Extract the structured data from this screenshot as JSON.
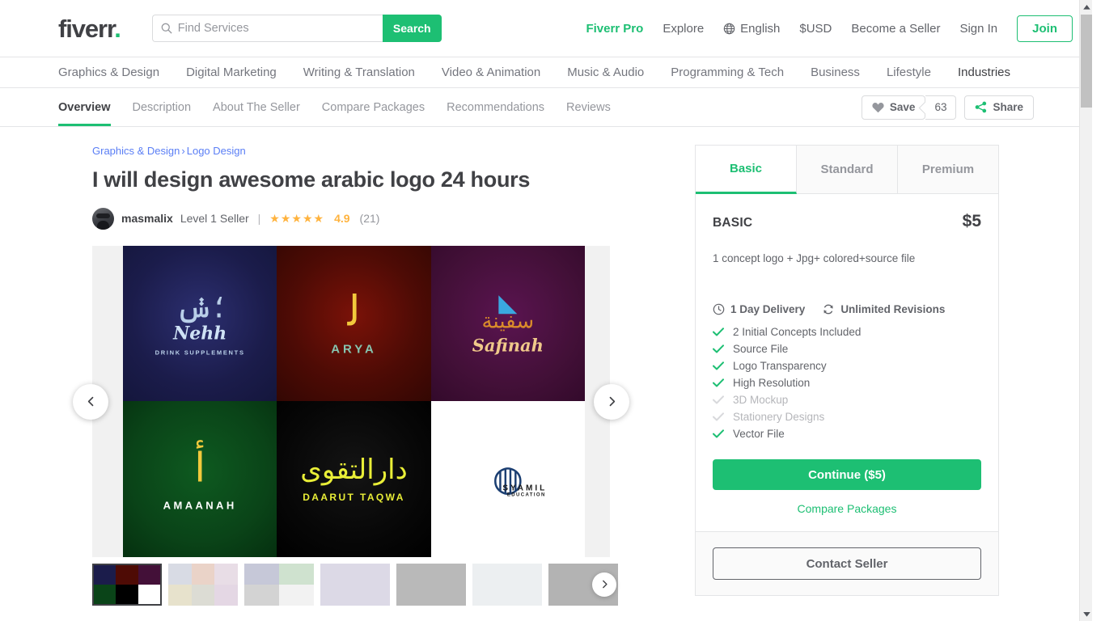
{
  "header": {
    "logo_text": "fiverr",
    "logo_dot": ".",
    "search_placeholder": "Find Services",
    "search_value": "",
    "search_button": "Search",
    "links": [
      {
        "label": "Fiverr Pro",
        "style": "pro"
      },
      {
        "label": "Explore",
        "style": "normal"
      },
      {
        "label": "English",
        "style": "normal",
        "icon": "globe-icon"
      },
      {
        "label": "$USD",
        "style": "normal"
      },
      {
        "label": "Become a Seller",
        "style": "normal"
      },
      {
        "label": "Sign In",
        "style": "normal"
      }
    ],
    "join_button": "Join"
  },
  "category_nav": {
    "items": [
      {
        "label": "Graphics & Design",
        "active": false
      },
      {
        "label": "Digital Marketing",
        "active": false
      },
      {
        "label": "Writing & Translation",
        "active": false
      },
      {
        "label": "Video & Animation",
        "active": false
      },
      {
        "label": "Music & Audio",
        "active": false
      },
      {
        "label": "Programming & Tech",
        "active": false
      },
      {
        "label": "Business",
        "active": false
      },
      {
        "label": "Lifestyle",
        "active": false
      },
      {
        "label": "Industries",
        "active": true
      }
    ]
  },
  "sub_nav": {
    "tabs": [
      {
        "label": "Overview",
        "active": true
      },
      {
        "label": "Description",
        "active": false
      },
      {
        "label": "About The Seller",
        "active": false
      },
      {
        "label": "Compare Packages",
        "active": false
      },
      {
        "label": "Recommendations",
        "active": false
      },
      {
        "label": "Reviews",
        "active": false
      }
    ],
    "save_label": "Save",
    "save_count": "63",
    "share_label": "Share"
  },
  "gig": {
    "breadcrumb": {
      "category": "Graphics & Design",
      "separator": "›",
      "subcategory": "Logo Design"
    },
    "title": "I will design awesome arabic logo 24 hours",
    "seller": {
      "name": "masmalix",
      "level": "Level 1 Seller",
      "divider": "|",
      "stars": "★★★★★",
      "rating": "4.9",
      "review_count": "(21)"
    }
  },
  "gallery": {
    "prev_label": "‹",
    "next_label": "›",
    "thumbs_next_label": "›",
    "slides": [
      {
        "name": "Nehh",
        "sub": "DRINK SUPPLEMENTS",
        "bg": "#1b1c4b",
        "fg": "#b9cfe8",
        "accent": "#e3c24a"
      },
      {
        "name": "ARYA",
        "sub": "",
        "bg": "#4e0b05",
        "fg": "#86c5b0",
        "accent": "#f2c93c"
      },
      {
        "name": "Safinah",
        "sub": "",
        "bg": "#431038",
        "fg": "#f0c98a",
        "accent": "#3aa8e0"
      },
      {
        "name": "AMAANAH",
        "sub": "",
        "bg": "#0a4418",
        "fg": "#ffffff",
        "accent": "#f2c93c"
      },
      {
        "name": "DAARUT TAQWA",
        "sub": "",
        "bg": "#000000",
        "fg": "#e9ee37",
        "accent": "#e9ee37"
      },
      {
        "name": "SYAMIL",
        "sub": "EDUCATION",
        "bg": "#ffffff",
        "fg": "#1c3f72",
        "accent": "#1c3f72"
      }
    ],
    "thumbnails": [
      {
        "label": "thumbnail-1",
        "active": true,
        "colors": [
          "#1b1c4b",
          "#4e0b05",
          "#431038",
          "#0a4418",
          "#000000",
          "#ffffff"
        ]
      },
      {
        "label": "thumbnail-2",
        "active": false,
        "colors": [
          "#d8dbe4",
          "#ead3c8",
          "#e8dde6",
          "#e7e2cc",
          "#dcdcd4",
          "#e4d7e4"
        ]
      },
      {
        "label": "thumbnail-3",
        "active": false,
        "colors": [
          "#c6c8d8",
          "#cfe2cf",
          "#c6c8d8",
          "#cfe2cf",
          "#d3d3d3",
          "#f2f2f2"
        ]
      },
      {
        "label": "thumbnail-4",
        "active": false,
        "colors": [
          "#dcd9e6",
          "#dcd9e6",
          "#dcd9e6",
          "#dcd9e6",
          "#dcd9e6",
          "#dcd9e6"
        ]
      },
      {
        "label": "thumbnail-5",
        "active": false,
        "colors": [
          "#b9b9b9",
          "#b9b9b9",
          "#b9b9b9",
          "#b9b9b9",
          "#b9b9b9",
          "#b9b9b9"
        ]
      },
      {
        "label": "thumbnail-6",
        "active": false,
        "colors": [
          "#eceff1",
          "#eceff1",
          "#eceff1",
          "#eceff1",
          "#eceff1",
          "#eceff1"
        ]
      },
      {
        "label": "thumbnail-7",
        "active": false,
        "colors": [
          "#b3b3b3",
          "#b3b3b3",
          "#b3b3b3",
          "#b3b3b3",
          "#b3b3b3",
          "#b3b3b3"
        ]
      }
    ]
  },
  "package": {
    "tabs": [
      {
        "label": "Basic",
        "active": true
      },
      {
        "label": "Standard",
        "active": false
      },
      {
        "label": "Premium",
        "active": false
      }
    ],
    "name": "BASIC",
    "price": "$5",
    "description": "1 concept logo + Jpg+ colored+source file",
    "delivery": "1 Day Delivery",
    "revisions": "Unlimited Revisions",
    "features": [
      {
        "label": "2 Initial Concepts Included",
        "included": true
      },
      {
        "label": "Source File",
        "included": true
      },
      {
        "label": "Logo Transparency",
        "included": true
      },
      {
        "label": "High Resolution",
        "included": true
      },
      {
        "label": "3D Mockup",
        "included": false
      },
      {
        "label": "Stationery Designs",
        "included": false
      },
      {
        "label": "Vector File",
        "included": true
      }
    ],
    "continue_button": "Continue ($5)",
    "compare_link": "Compare Packages",
    "contact_button": "Contact Seller"
  },
  "colors": {
    "brand_green": "#1dbf73",
    "text_dark": "#404145",
    "text_grey": "#62646a",
    "text_light": "#95979d",
    "link_blue": "#5a7ef5",
    "star_gold": "#ffb33e"
  }
}
